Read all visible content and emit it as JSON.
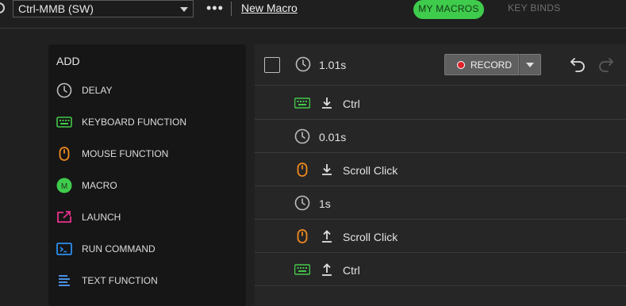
{
  "topbar": {
    "profile": "Ctrl-MMB (SW)",
    "more": "•••",
    "macro_name": "New Macro",
    "tabs": [
      "MY MACROS",
      "KEY BINDS"
    ]
  },
  "colors": {
    "accent": "#3fcb4c",
    "keyboard_icon": "#43c84a",
    "mouse_icon": "#ef8a1f",
    "launch_icon": "#e8328a",
    "command_icon": "#2b8ff0",
    "text_icon": "#4a90e2",
    "record_dot": "#e0202a"
  },
  "add_panel": {
    "title": "ADD",
    "items": [
      {
        "label": "DELAY",
        "icon": "clock-icon"
      },
      {
        "label": "KEYBOARD FUNCTION",
        "icon": "keyboard-icon"
      },
      {
        "label": "MOUSE FUNCTION",
        "icon": "mouse-icon"
      },
      {
        "label": "MACRO",
        "icon": "macro-icon",
        "badge": "M"
      },
      {
        "label": "LAUNCH",
        "icon": "launch-icon"
      },
      {
        "label": "RUN COMMAND",
        "icon": "terminal-icon"
      },
      {
        "label": "TEXT FUNCTION",
        "icon": "text-lines-icon"
      }
    ]
  },
  "editor": {
    "total_time": "1.01s",
    "record_label": "RECORD",
    "steps": [
      {
        "type": "keyboard",
        "direction": "down",
        "text": "Ctrl"
      },
      {
        "type": "delay",
        "text": "0.01s"
      },
      {
        "type": "mouse",
        "direction": "down",
        "text": "Scroll Click"
      },
      {
        "type": "delay",
        "text": "1s"
      },
      {
        "type": "mouse",
        "direction": "up",
        "text": "Scroll Click"
      },
      {
        "type": "keyboard",
        "direction": "up",
        "text": "Ctrl"
      }
    ]
  }
}
